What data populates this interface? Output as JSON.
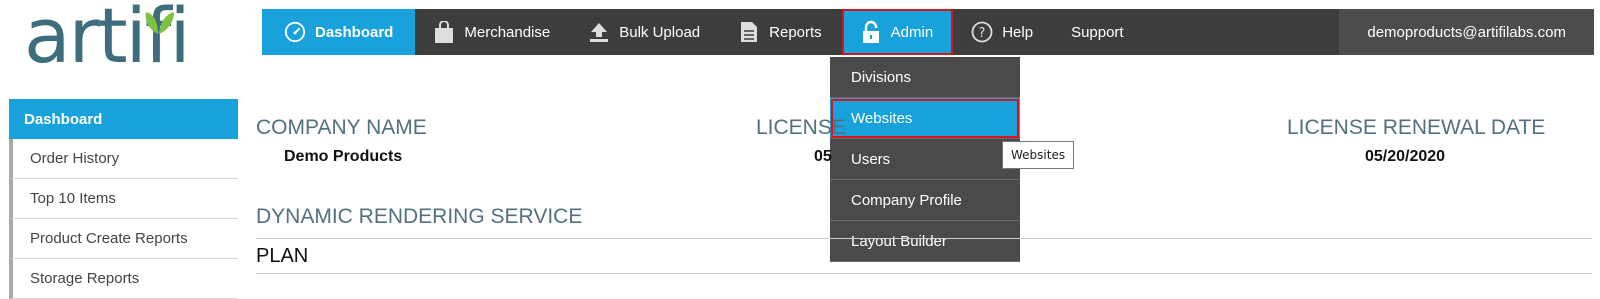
{
  "logo": {
    "text": "artifi"
  },
  "nav": {
    "items": [
      {
        "label": "Dashboard",
        "icon": "dashboard-gauge-icon"
      },
      {
        "label": "Merchandise",
        "icon": "shopping-bag-icon"
      },
      {
        "label": "Bulk Upload",
        "icon": "upload-icon"
      },
      {
        "label": "Reports",
        "icon": "document-icon"
      },
      {
        "label": "Admin",
        "icon": "lock-icon"
      },
      {
        "label": "Help",
        "icon": "help-circle-icon"
      },
      {
        "label": "Support",
        "icon": ""
      }
    ],
    "user_email": "demoproducts@artifilabs.com"
  },
  "admin_menu": {
    "items": [
      "Divisions",
      "Websites",
      "Users",
      "Company Profile",
      "Layout Builder"
    ],
    "selected": "Websites",
    "tooltip": "Websites"
  },
  "sidebar": {
    "active": "Dashboard",
    "items": [
      "Order History",
      "Top 10 Items",
      "Product Create Reports",
      "Storage Reports"
    ]
  },
  "main": {
    "company_label": "COMPANY NAME",
    "company_value": "Demo Products",
    "license_label": "LICENSE",
    "license_value": "05",
    "renewal_label": "LICENSE RENEWAL DATE",
    "renewal_value": "05/20/2020",
    "service_label": "DYNAMIC RENDERING SERVICE",
    "plan_label": "PLAN"
  },
  "colors": {
    "accent": "#19a1dc",
    "nav_bg": "#3d3d3d",
    "highlight": "#d8141e",
    "heading": "#52707e"
  }
}
